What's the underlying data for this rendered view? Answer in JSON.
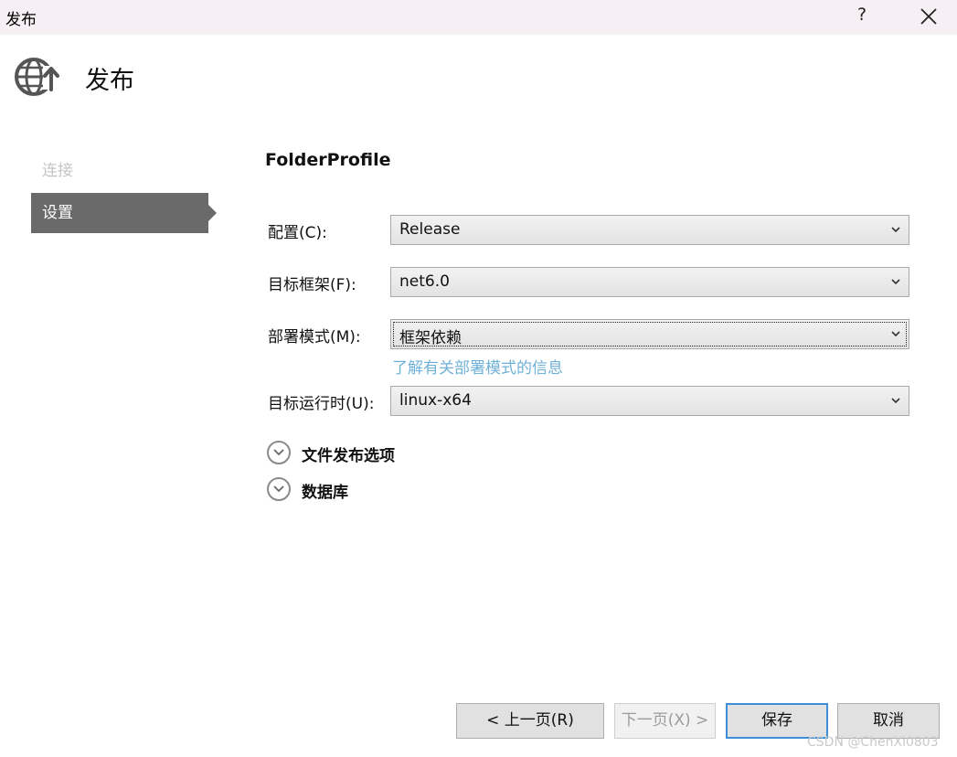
{
  "window": {
    "title": "发布",
    "help_label": "?"
  },
  "header": {
    "title": "发布",
    "icon": "globe-publish-icon"
  },
  "nav": {
    "items": [
      {
        "label": "连接",
        "state": "disabled"
      },
      {
        "label": "设置",
        "state": "selected"
      }
    ]
  },
  "profile": {
    "name": "FolderProfile"
  },
  "fields": {
    "configuration": {
      "label": "配置(C):",
      "value": "Release"
    },
    "target_framework": {
      "label": "目标框架(F):",
      "value": "net6.0"
    },
    "deployment_mode": {
      "label": "部署模式(M):",
      "value": "框架依赖",
      "help_link": "了解有关部署模式的信息"
    },
    "target_runtime": {
      "label": "目标运行时(U):",
      "value": "linux-x64"
    }
  },
  "sections": {
    "file_publish_options": "文件发布选项",
    "databases": "数据库"
  },
  "buttons": {
    "previous": "< 上一页(R)",
    "next": "下一页(X) >",
    "save": "保存",
    "cancel": "取消"
  },
  "watermark": "CSDN @ChenXi0803",
  "colors": {
    "titlebar_bg": "#f6eff3",
    "nav_selected_bg": "#6a6a6a",
    "link": "#6fb1d8",
    "default_button_border": "#3c8fd6"
  }
}
